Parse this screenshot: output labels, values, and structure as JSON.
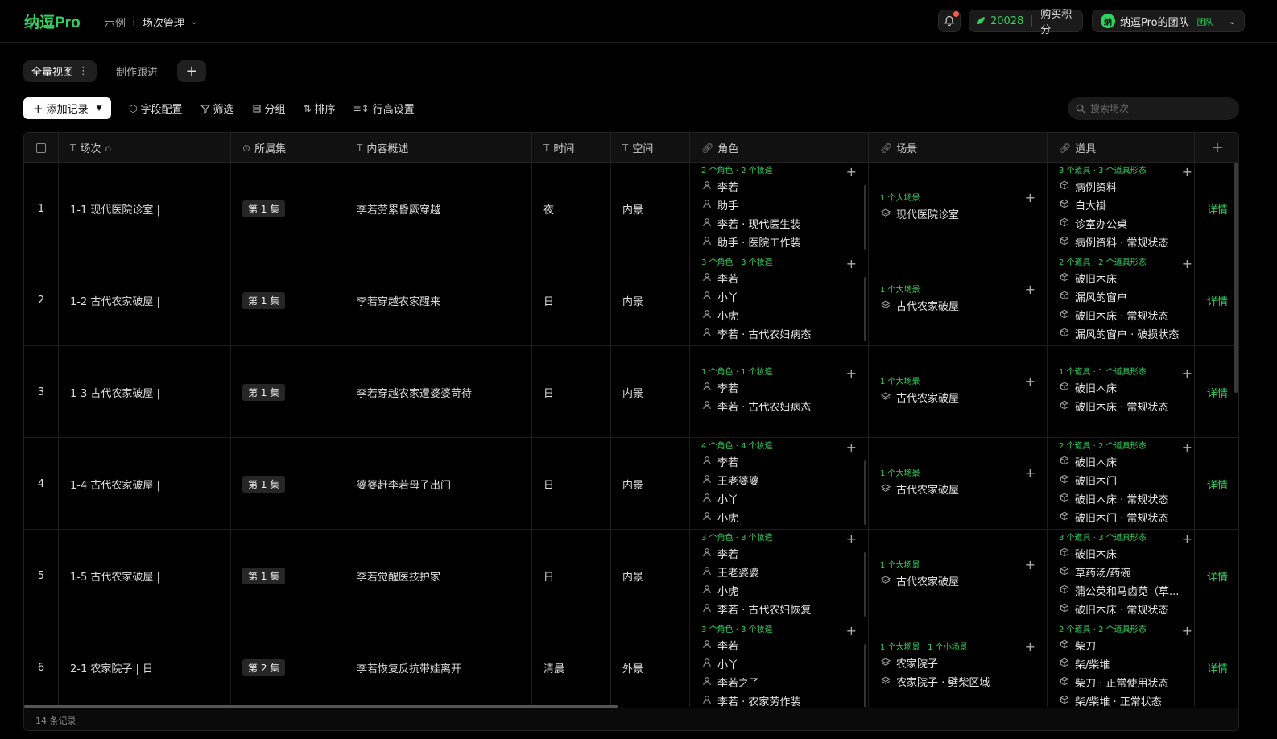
{
  "topbar": {
    "logo": "纳逗Pro",
    "breadcrumb": [
      "示例",
      "场次管理"
    ],
    "credits_value": "20028",
    "buy_label": "购买积分",
    "team_avatar": "纳",
    "team_name": "纳逗Pro的团队",
    "team_badge": "团队"
  },
  "views": {
    "tabs": [
      "全量视图",
      "制作跟进"
    ],
    "add_label": "+"
  },
  "toolbar": {
    "add_record": "添加记录",
    "field_config": "字段配置",
    "filter": "筛选",
    "group": "分组",
    "sort": "排序",
    "row_height": "行高设置",
    "search_placeholder": "搜索场次"
  },
  "columns": [
    {
      "label": "场次",
      "icon": "T"
    },
    {
      "label": "所属集",
      "icon": "⊙"
    },
    {
      "label": "内容概述",
      "icon": "T"
    },
    {
      "label": "时间",
      "icon": "T"
    },
    {
      "label": "空间",
      "icon": "T"
    },
    {
      "label": "角色",
      "icon": "link"
    },
    {
      "label": "场景",
      "icon": "link"
    },
    {
      "label": "道具",
      "icon": "link"
    }
  ],
  "detail_label": "详情",
  "rows": [
    {
      "num": "1",
      "scene": "1-1 现代医院诊室 |",
      "episode": "第 1 集",
      "summary": "李若劳累昏厥穿越",
      "time": "夜",
      "space": "内景",
      "roles_summary": "2 个角色 · 2 个妆造",
      "roles": [
        "李若",
        "助手",
        "李若 · 现代医生装",
        "助手 · 医院工作装"
      ],
      "places_summary": "1 个大场景",
      "places": [
        "现代医院诊室"
      ],
      "props_summary": "3 个道具 · 3 个道具形态",
      "props": [
        "病例资料",
        "白大褂",
        "诊室办公桌",
        "病例资料 · 常规状态"
      ]
    },
    {
      "num": "2",
      "scene": "1-2 古代农家破屋 |",
      "episode": "第 1 集",
      "summary": "李若穿越农家醒来",
      "time": "日",
      "space": "内景",
      "roles_summary": "3 个角色 · 3 个妆造",
      "roles": [
        "李若",
        "小丫",
        "小虎",
        "李若 · 古代农妇病态"
      ],
      "places_summary": "1 个大场景",
      "places": [
        "古代农家破屋"
      ],
      "props_summary": "2 个道具 · 2 个道具形态",
      "props": [
        "破旧木床",
        "漏风的窗户",
        "破旧木床 · 常规状态",
        "漏风的窗户 · 破损状态"
      ]
    },
    {
      "num": "3",
      "scene": "1-3 古代农家破屋 |",
      "episode": "第 1 集",
      "summary": "李若穿越农家遭婆婆苛待",
      "time": "日",
      "space": "内景",
      "roles_summary": "1 个角色 · 1 个妆造",
      "roles": [
        "李若",
        "李若 · 古代农妇病态"
      ],
      "places_summary": "1 个大场景",
      "places": [
        "古代农家破屋"
      ],
      "props_summary": "1 个道具 · 1 个道具形态",
      "props": [
        "破旧木床",
        "破旧木床 · 常规状态"
      ]
    },
    {
      "num": "4",
      "scene": "1-4 古代农家破屋 |",
      "episode": "第 1 集",
      "summary": "婆婆赶李若母子出门",
      "time": "日",
      "space": "内景",
      "roles_summary": "4 个角色 · 4 个妆造",
      "roles": [
        "李若",
        "王老婆婆",
        "小丫",
        "小虎"
      ],
      "places_summary": "1 个大场景",
      "places": [
        "古代农家破屋"
      ],
      "props_summary": "2 个道具 · 2 个道具形态",
      "props": [
        "破旧木床",
        "破旧木门",
        "破旧木床 · 常规状态",
        "破旧木门 · 常规状态"
      ]
    },
    {
      "num": "5",
      "scene": "1-5 古代农家破屋 |",
      "episode": "第 1 集",
      "summary": "李若觉醒医技护家",
      "time": "日",
      "space": "内景",
      "roles_summary": "3 个角色 · 3 个妆造",
      "roles": [
        "李若",
        "王老婆婆",
        "小虎",
        "李若 · 古代农妇恢复"
      ],
      "places_summary": "1 个大场景",
      "places": [
        "古代农家破屋"
      ],
      "props_summary": "3 个道具 · 3 个道具形态",
      "props": [
        "破旧木床",
        "草药汤/药碗",
        "蒲公英和马齿苋（草...",
        "破旧木床 · 常规状态"
      ]
    },
    {
      "num": "6",
      "scene": "2-1 农家院子 | 日",
      "episode": "第 2 集",
      "summary": "李若恢复反抗带娃离开",
      "time": "清晨",
      "space": "外景",
      "roles_summary": "3 个角色 · 3 个妆造",
      "roles": [
        "李若",
        "小丫",
        "李若之子",
        "李若 · 农家劳作装"
      ],
      "places_summary": "1 个大场景 · 1 个小场景",
      "places": [
        "农家院子",
        "农家院子 · 劈柴区域"
      ],
      "props_summary": "2 个道具 · 2 个道具形态",
      "props": [
        "柴刀",
        "柴/柴堆",
        "柴刀 · 正常使用状态",
        "柴/柴堆 · 正常状态"
      ]
    }
  ],
  "footer": {
    "count": "14 条记录"
  }
}
